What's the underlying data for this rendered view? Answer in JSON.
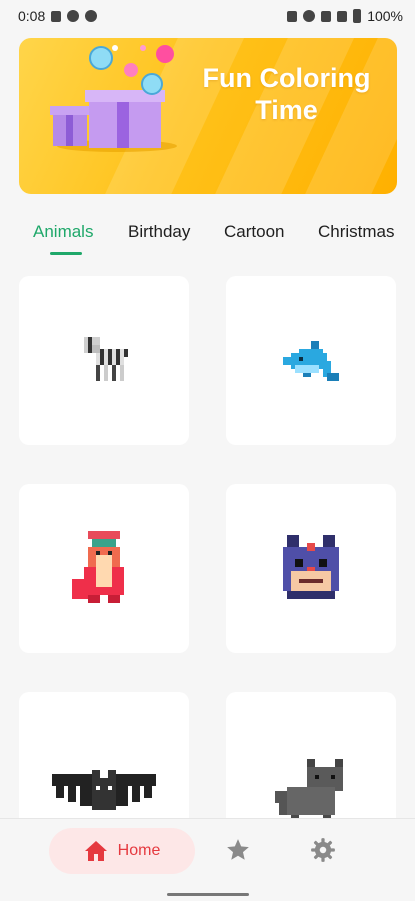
{
  "status_bar": {
    "time": "0:08",
    "battery": "100%"
  },
  "banner": {
    "title": "Fun Coloring Time"
  },
  "tabs": [
    {
      "label": "Animals",
      "active": true
    },
    {
      "label": "Birthday",
      "active": false
    },
    {
      "label": "Cartoon",
      "active": false
    },
    {
      "label": "Christmas",
      "active": false
    }
  ],
  "gallery": [
    {
      "subject": "zebra"
    },
    {
      "subject": "dolphin"
    },
    {
      "subject": "fox"
    },
    {
      "subject": "squirrel"
    },
    {
      "subject": "bat"
    },
    {
      "subject": "cat"
    }
  ],
  "bottom_nav": {
    "home_label": "Home",
    "accent": "#e5393f"
  },
  "colors": {
    "accent_green": "#1fa86a",
    "banner_yellow": "#ffc21a"
  }
}
